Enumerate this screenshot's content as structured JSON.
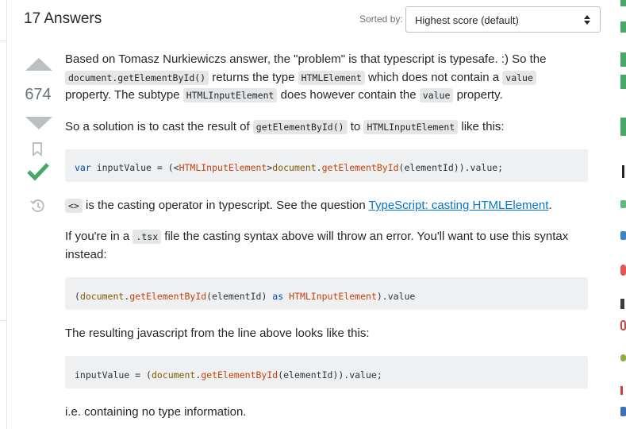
{
  "header": {
    "answers_count": "17 Answers",
    "sorted_by_label": "Sorted by:",
    "sort_value": "Highest score (default)"
  },
  "answer": {
    "vote_count": "674",
    "p1": {
      "t1": "Based on Tomasz Nurkiewiczs answer, the \"problem\" is that typescript is typesafe. :) So the",
      "c1": "document.getElementById()",
      "t2": " returns the type ",
      "c2": "HTMLElement",
      "t3": " which does not contain a ",
      "c3": "value",
      "t4": "property. The subtype ",
      "c4": "HTMLInputElement",
      "t5": " does however contain the ",
      "c5": "value",
      "t6": " property."
    },
    "p2": {
      "t1": "So a solution is to cast the result of ",
      "c1": "getElementById()",
      "t2": " to ",
      "c2": "HTMLInputElement",
      "t3": " like this:"
    },
    "code1": {
      "a": "var",
      "b": " inputValue = (<",
      "c": "HTMLInputElement",
      "d": ">",
      "e": "document",
      "f": ".",
      "g": "getElementById",
      "h": "(elementId)).value;"
    },
    "p3": {
      "c1": "<>",
      "t1": " is the casting operator in typescript. See the question ",
      "link": "TypeScript: casting HTMLElement",
      "t2": "."
    },
    "p4": {
      "t1": "If you're in a ",
      "c1": ".tsx",
      "t2": " file the casting syntax above will throw an error. You'll want to use this syntax",
      "t3": "instead:"
    },
    "code2": {
      "a": "(",
      "b": "document",
      "c": ".",
      "d": "getElementById",
      "e": "(elementId) ",
      "f": "as",
      "g": " ",
      "h": "HTMLInputElement",
      "i": ").value"
    },
    "p5": "The resulting javascript from the line above looks like this:",
    "code3": {
      "a": "inputValue = (",
      "b": "document",
      "c": ".",
      "d": "getElementById",
      "e": "(elementId)).value;"
    },
    "p6": "i.e. containing no type information."
  },
  "colors": {
    "accent_green": "#48a868",
    "link_blue": "#0077cc",
    "vote_gray": "#bbc0c4"
  }
}
